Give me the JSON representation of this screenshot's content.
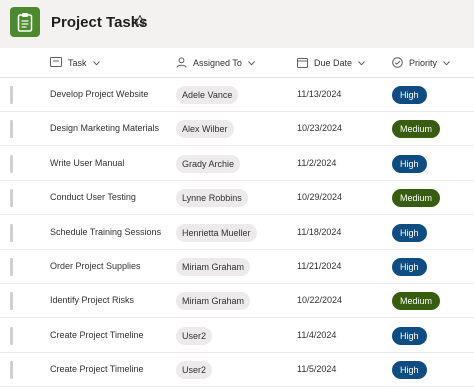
{
  "header": {
    "title": "Project Tasks",
    "app_icon": "clipboard-icon",
    "app_icon_color": "#4c8a2d",
    "favorite_icon": "star-outline-icon"
  },
  "columns": [
    {
      "label": "Task",
      "icon": "text-icon"
    },
    {
      "label": "Assigned To",
      "icon": "person-icon"
    },
    {
      "label": "Due Date",
      "icon": "calendar-icon"
    },
    {
      "label": "Priority",
      "icon": "choice-icon"
    }
  ],
  "priority_colors": {
    "High": "#0f4c81",
    "Medium": "#385c10"
  },
  "rows": [
    {
      "task": "Develop Project Website",
      "assigned": "Adele Vance",
      "due": "11/13/2024",
      "priority": "High"
    },
    {
      "task": "Design Marketing Materials",
      "assigned": "Alex Wilber",
      "due": "10/23/2024",
      "priority": "Medium"
    },
    {
      "task": "Write User Manual",
      "assigned": "Grady Archie",
      "due": "11/2/2024",
      "priority": "High"
    },
    {
      "task": "Conduct User Testing",
      "assigned": "Lynne Robbins",
      "due": "10/29/2024",
      "priority": "Medium"
    },
    {
      "task": "Schedule Training Sessions",
      "assigned": "Henrietta Mueller",
      "due": "11/18/2024",
      "priority": "High"
    },
    {
      "task": "Order Project Supplies",
      "assigned": "Miriam Graham",
      "due": "11/21/2024",
      "priority": "High"
    },
    {
      "task": "Identify Project Risks",
      "assigned": "Miriam Graham",
      "due": "10/22/2024",
      "priority": "Medium"
    },
    {
      "task": "Create Project Timeline",
      "assigned": "User2",
      "due": "11/4/2024",
      "priority": "High"
    },
    {
      "task": "Create Project Timeline",
      "assigned": "User2",
      "due": "11/5/2024",
      "priority": "High"
    }
  ]
}
